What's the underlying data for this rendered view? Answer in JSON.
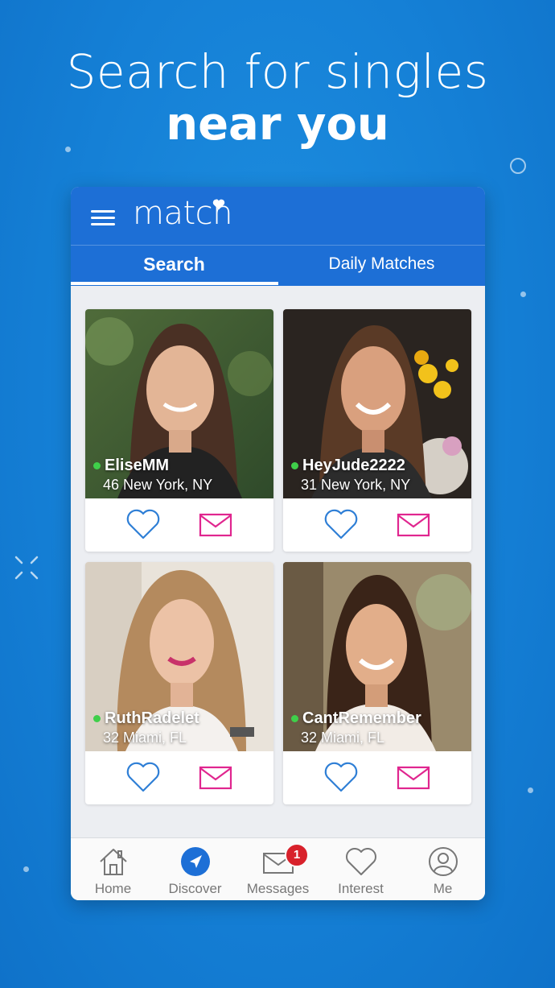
{
  "headline": {
    "line1": "Search for singles",
    "line2": "near you"
  },
  "app": {
    "logo_text": "match",
    "tabs": [
      {
        "label": "Search",
        "active": true
      },
      {
        "label": "Daily Matches",
        "active": false
      }
    ]
  },
  "profiles": [
    {
      "username": "EliseMM",
      "age_location": "46 New York, NY",
      "online": true
    },
    {
      "username": "HeyJude2222",
      "age_location": "31 New York, NY",
      "online": true
    },
    {
      "username": "RuthRadelet",
      "age_location": "32 Miami, FL",
      "online": true
    },
    {
      "username": "CantRemember",
      "age_location": "32 Miami, FL",
      "online": true
    }
  ],
  "bottom_nav": [
    {
      "label": "Home",
      "icon": "home-icon"
    },
    {
      "label": "Discover",
      "icon": "discover-icon",
      "active": true
    },
    {
      "label": "Messages",
      "icon": "messages-icon",
      "badge": "1"
    },
    {
      "label": "Interest",
      "icon": "interest-icon"
    },
    {
      "label": "Me",
      "icon": "me-icon"
    }
  ],
  "colors": {
    "background": "#1580d6",
    "app_bar": "#1d6fd6",
    "heart_icon": "#2f7fd6",
    "mail_icon": "#e0268f",
    "online": "#3fcf4a",
    "badge": "#d8212b"
  }
}
